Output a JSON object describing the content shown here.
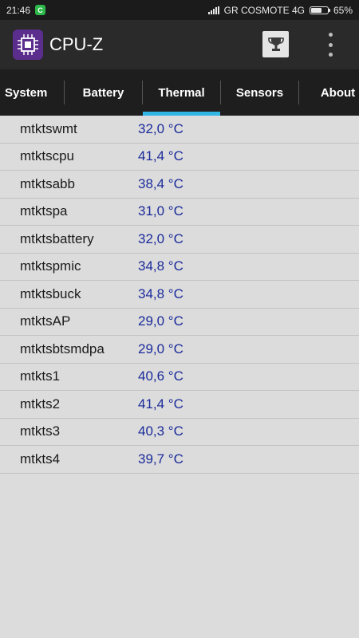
{
  "statusbar": {
    "time": "21:46",
    "carrier": "GR COSMOTE 4G",
    "battery_percent": "65%",
    "battery_level": 0.65
  },
  "appbar": {
    "title": "CPU-Z",
    "icons": [
      "cpu-chip-icon",
      "trophy-icon",
      "overflow-menu-icon"
    ]
  },
  "tabs": [
    {
      "label": "System"
    },
    {
      "label": "Battery"
    },
    {
      "label": "Thermal",
      "active": true
    },
    {
      "label": "Sensors"
    },
    {
      "label": "About"
    }
  ],
  "thermal": [
    {
      "name": "mtktswmt",
      "value": "32,0 °C"
    },
    {
      "name": "mtktscpu",
      "value": "41,4 °C"
    },
    {
      "name": "mtktsabb",
      "value": "38,4 °C"
    },
    {
      "name": "mtktspa",
      "value": "31,0 °C"
    },
    {
      "name": "mtktsbattery",
      "value": "32,0 °C"
    },
    {
      "name": "mtktspmic",
      "value": "34,8 °C"
    },
    {
      "name": "mtktsbuck",
      "value": "34,8 °C"
    },
    {
      "name": "mtktsAP",
      "value": "29,0 °C"
    },
    {
      "name": "mtktsbtsmdpa",
      "value": "29,0 °C"
    },
    {
      "name": "mtkts1",
      "value": "40,6 °C"
    },
    {
      "name": "mtkts2",
      "value": "41,4 °C"
    },
    {
      "name": "mtkts3",
      "value": "40,3 °C"
    },
    {
      "name": "mtkts4",
      "value": "39,7 °C"
    }
  ],
  "colors": {
    "accent": "#33b5e5",
    "value_text": "#1a2a9a",
    "app_icon_bg": "#5b2e8e"
  }
}
